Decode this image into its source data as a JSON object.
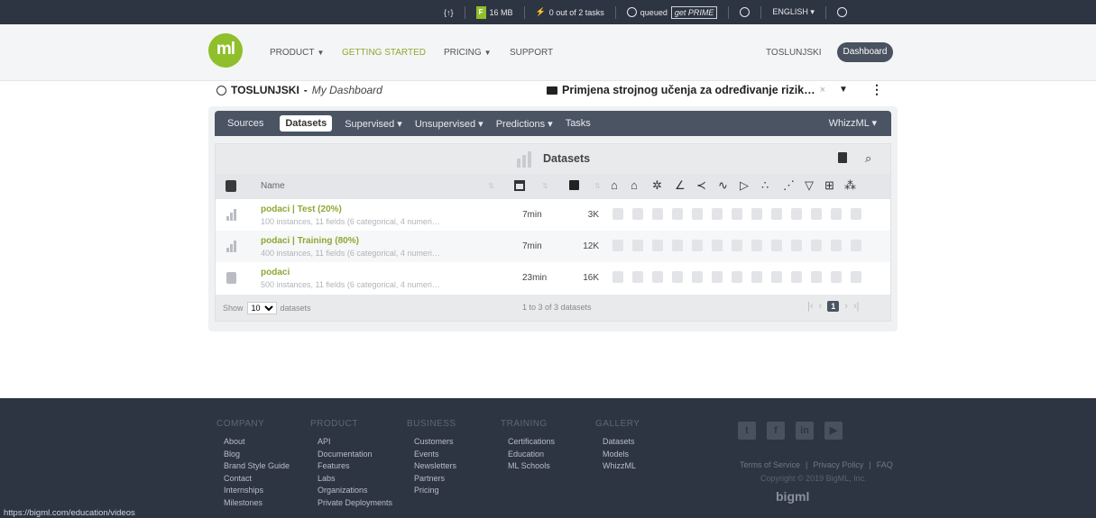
{
  "topbar": {
    "code_label": "{↑}",
    "storage": "16 MB",
    "tasks": "0 out of 2 tasks",
    "queued": "queued",
    "prime": "get PRIME",
    "language": "ENGLISH ▾"
  },
  "nav": {
    "logo": "ml",
    "items": [
      "PRODUCT",
      "GETTING STARTED",
      "PRICING",
      "SUPPORT"
    ],
    "user": "TOSLUNJSKI",
    "dashboard": "Dashboard"
  },
  "dash": {
    "user": "TOSLUNJSKI",
    "subtitle": "My Dashboard",
    "project": "Primjena strojnog učenja za određivanje rizik…"
  },
  "tabs": {
    "items": [
      "Sources",
      "Datasets",
      "Supervised ▾",
      "Unsupervised ▾",
      "Predictions ▾",
      "Tasks"
    ],
    "right": "WhizzML ▾"
  },
  "table": {
    "title": "Datasets",
    "col_name": "Name",
    "rows": [
      {
        "name": "podaci | Test (20%)",
        "desc": "100 instances, 11 fields (6 categorical, 4 numeri…",
        "age": "7min",
        "size": "3K"
      },
      {
        "name": "podaci | Training (80%)",
        "desc": "400 instances, 11 fields (6 categorical, 4 numeri…",
        "age": "7min",
        "size": "12K"
      },
      {
        "name": "podaci",
        "desc": "500 instances, 11 fields (6 categorical, 4 numeri…",
        "age": "23min",
        "size": "16K"
      }
    ],
    "show_label": "Show",
    "show_value": "10",
    "show_suffix": "datasets",
    "count": "1 to 3 of 3 datasets",
    "page": "1"
  },
  "footer": {
    "columns": [
      {
        "head": "COMPANY",
        "items": [
          "About",
          "Blog",
          "Brand Style Guide",
          "Contact",
          "Internships",
          "Milestones"
        ]
      },
      {
        "head": "PRODUCT",
        "items": [
          "API",
          "Documentation",
          "Features",
          "Labs",
          "Organizations",
          "Private Deployments"
        ]
      },
      {
        "head": "BUSINESS",
        "items": [
          "Customers",
          "Events",
          "Newsletters",
          "Partners",
          "Pricing"
        ]
      },
      {
        "head": "TRAINING",
        "items": [
          "Certifications",
          "Education",
          "ML Schools"
        ]
      },
      {
        "head": "GALLERY",
        "items": [
          "Datasets",
          "Models",
          "WhizzML"
        ]
      }
    ],
    "terms": "Terms of Service",
    "privacy": "Privacy Policy",
    "faq": "FAQ",
    "copyright": "Copyright © 2019 BigML, Inc.",
    "brand": "bigml"
  },
  "status_url": "https://bigml.com/education/videos"
}
